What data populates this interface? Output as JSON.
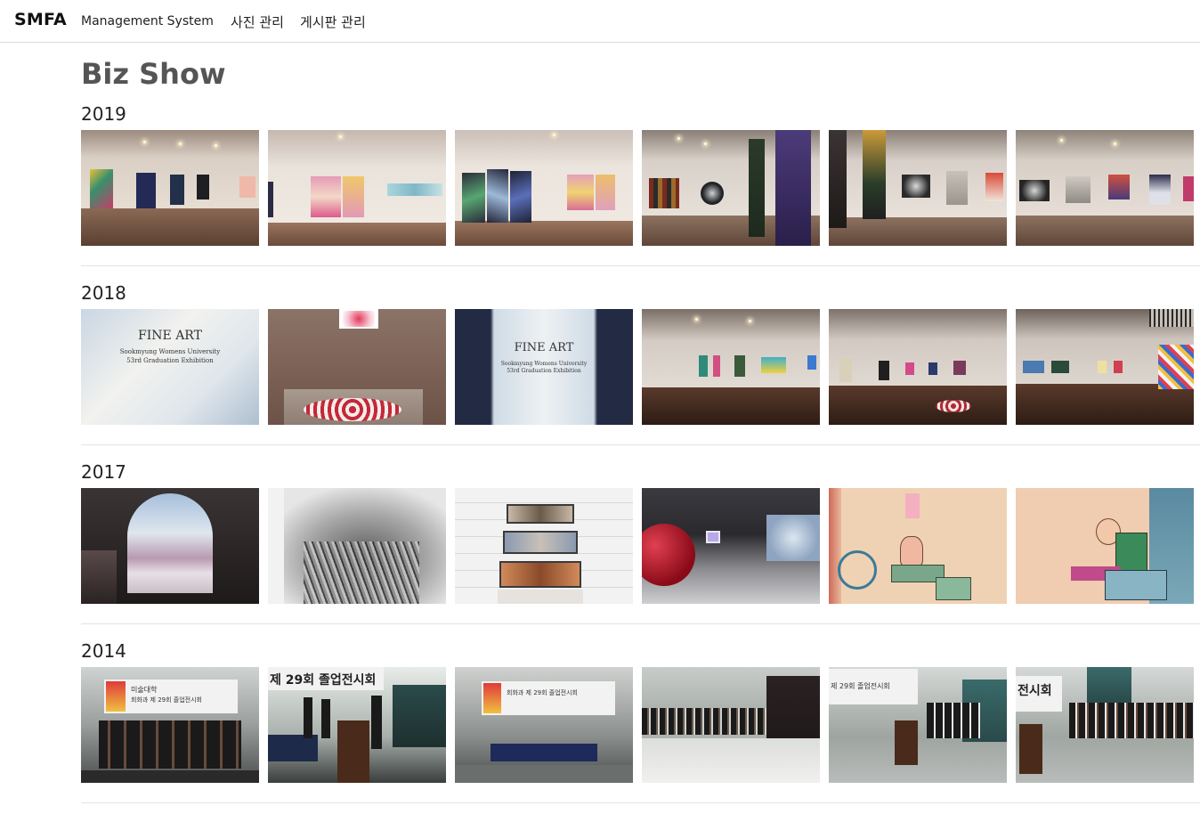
{
  "nav": {
    "brand": "SMFA",
    "subtitle": "Management System",
    "links": [
      "사진 관리",
      "게시판 관리"
    ]
  },
  "page": {
    "title": "Biz Show"
  },
  "sections": [
    {
      "year": "2019",
      "photo_count": 6
    },
    {
      "year": "2018",
      "photo_count": 6,
      "poster_text": {
        "title": "FINE ART",
        "line1": "Sookmyung Womens University",
        "line2": "53rd Graduation Exhibition"
      }
    },
    {
      "year": "2017",
      "photo_count": 6
    },
    {
      "year": "2014",
      "photo_count": 6,
      "banner_text": {
        "college": "미술대학",
        "dept": "회화과 제 29회 졸업전시회",
        "short": "제 29회 졸업전시회",
        "tail": "전시회"
      }
    }
  ]
}
